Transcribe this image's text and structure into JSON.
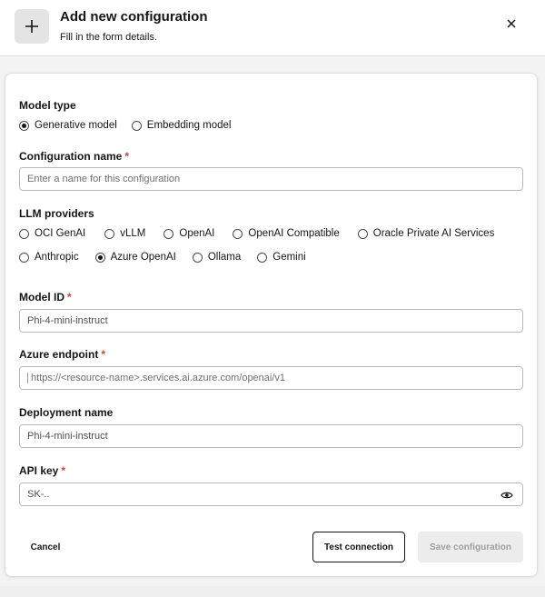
{
  "header": {
    "title": "Add new configuration",
    "subtitle": "Fill in the form details.",
    "icon": "plus-icon",
    "close_icon": "close-icon"
  },
  "model_type": {
    "label": "Model type",
    "options": [
      "Generative model",
      "Embedding model"
    ],
    "selected": "Generative model"
  },
  "configuration_name": {
    "label": "Configuration name",
    "required_mark": "*",
    "value": "",
    "placeholder": "Enter a name for this configuration"
  },
  "llm_providers": {
    "label": "LLM providers",
    "row1": [
      "OCI GenAI",
      "vLLM",
      "OpenAI",
      "OpenAI Compatible",
      "Oracle Private AI Services"
    ],
    "row2": [
      "Anthropic",
      "Azure OpenAI",
      "Ollama",
      "Gemini"
    ],
    "selected": "Azure OpenAI"
  },
  "model_id": {
    "label": "Model ID",
    "required_mark": "*",
    "value": "Phi-4-mini-instruct"
  },
  "azure_endpoint": {
    "label": "Azure endpoint",
    "required_mark": "*",
    "placeholder": "https://<resource-name>.services.ai.azure.com/openai/v1"
  },
  "deployment_name": {
    "label": "Deployment name",
    "value": "Phi-4-mini-instruct"
  },
  "api_key": {
    "label": "API key",
    "required_mark": "*",
    "value": "SK-..",
    "visibility_icon": "eye-icon"
  },
  "actions": {
    "cancel": "Cancel",
    "test": "Test connection",
    "save": "Save configuration"
  },
  "colors": {
    "required": "#c74634",
    "text": "#161513",
    "disabled_bg": "#ececec",
    "disabled_text": "#9f9f9f"
  }
}
